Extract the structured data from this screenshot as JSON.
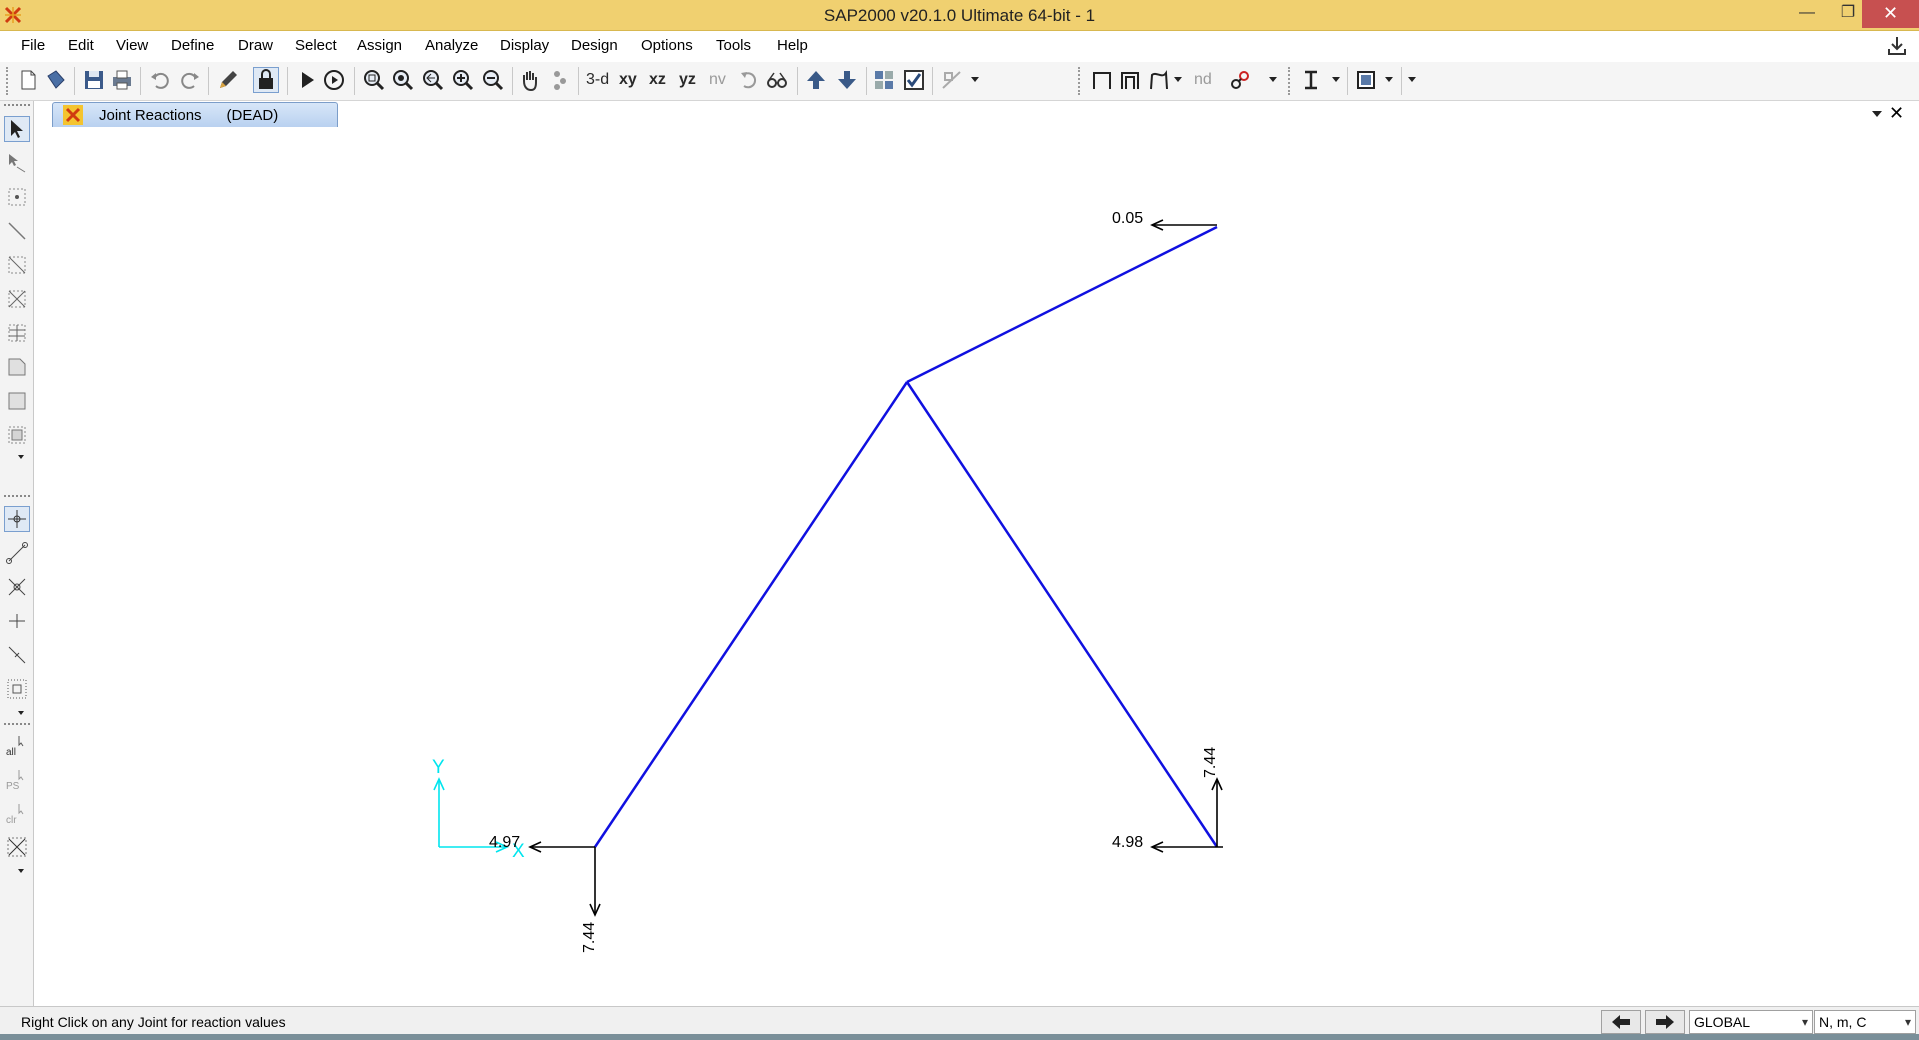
{
  "window": {
    "title": "SAP2000 v20.1.0 Ultimate 64-bit - 1",
    "minimize_glyph": "—",
    "maximize_glyph": "❐",
    "close_glyph": "✕"
  },
  "menu": {
    "items": [
      "File",
      "Edit",
      "View",
      "Define",
      "Draw",
      "Select",
      "Assign",
      "Analyze",
      "Display",
      "Design",
      "Options",
      "Tools",
      "Help"
    ]
  },
  "toolbar": {
    "view_3d": "3-d",
    "view_xy": "xy",
    "view_xz": "xz",
    "view_yz": "yz",
    "view_nv": "nv",
    "nd_label": "nd",
    "icons": [
      "new-model-icon",
      "open-icon",
      "save-icon",
      "print-icon",
      "undo-icon",
      "redo-icon",
      "edit-pencil-icon",
      "lock-icon",
      "run-analysis-icon",
      "run-animation-icon",
      "rubber-band-zoom-icon",
      "restore-full-view-icon",
      "previous-zoom-icon",
      "zoom-in-icon",
      "zoom-out-icon",
      "pan-icon",
      "rotate-3d-icon",
      "perspective-icon",
      "set-display-options-icon",
      "move-up-icon",
      "move-down-icon",
      "show-undeformed-icon",
      "show-deformed-icon",
      "show-forces-icon"
    ]
  },
  "left_toolbar": {
    "select_all_label": "all",
    "previous_select_label": "PS",
    "clear_select_label": "clr"
  },
  "document_tab": {
    "label": "Joint Reactions      (DEAD)"
  },
  "model": {
    "units_note": "reactions shown in N",
    "joints": [
      {
        "id": "left-support",
        "x": 0,
        "y": 0
      },
      {
        "id": "apex",
        "x": 5,
        "y": 7.4
      },
      {
        "id": "right-support",
        "x": 10,
        "y": 0
      },
      {
        "id": "top-right",
        "x": 10,
        "y": 10
      }
    ],
    "frames": [
      {
        "from": "left-support",
        "to": "apex"
      },
      {
        "from": "apex",
        "to": "right-support"
      },
      {
        "from": "apex",
        "to": "top-right"
      }
    ],
    "reactions": [
      {
        "joint": "left-support",
        "direction": "-x",
        "value": "4.97"
      },
      {
        "joint": "left-support",
        "direction": "-y",
        "value": "7.44"
      },
      {
        "joint": "right-support",
        "direction": "-x",
        "value": "4.98"
      },
      {
        "joint": "right-support",
        "direction": "+y",
        "value": "7.44"
      },
      {
        "joint": "top-right",
        "direction": "-x",
        "value": "0.05"
      }
    ],
    "axes": {
      "x_label": "X",
      "y_label": "Y",
      "color": "#00e5ee"
    },
    "frame_color": "#1010e0"
  },
  "status": {
    "message": "Right Click on any Joint for reaction values",
    "coord_system": "GLOBAL",
    "units": "N, m, C"
  }
}
